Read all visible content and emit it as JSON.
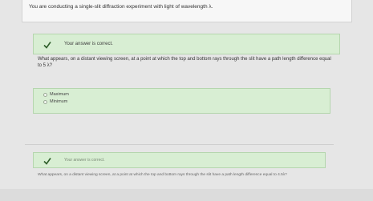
{
  "header": {
    "prompt": "You are conducting a single-slit diffraction experiment with light of wavelength λ."
  },
  "part1": {
    "feedback": "Your answer is correct.",
    "question": "What appears, on a distant viewing screen, at a point at which the top and bottom rays through the slit have a path length difference equal to 5 λ?",
    "options": [
      "Maximum",
      "Minimum"
    ]
  },
  "part2": {
    "feedback": "Your answer is correct.",
    "question": "What appears, on a distant viewing screen, at a point at which the top and bottom rays through the slit have a path length difference equal to 4.5λ?"
  },
  "colors": {
    "success_bg": "#d8eed3",
    "success_border": "#b5d6ae",
    "check": "#2e5d2a"
  },
  "icons": {
    "feedback": "checkmark-icon",
    "option": "radio-icon"
  }
}
